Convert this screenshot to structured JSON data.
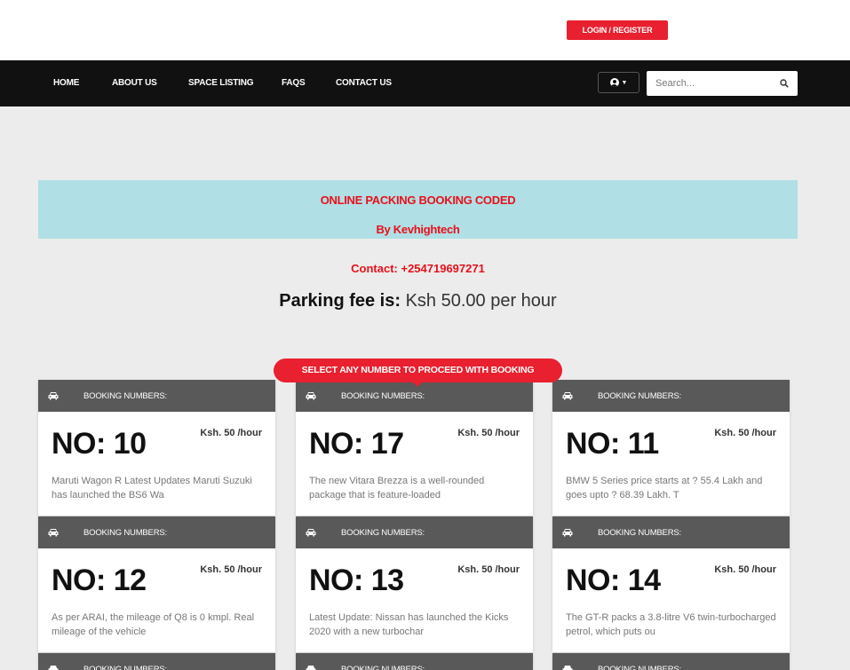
{
  "header": {
    "login_label": "LOGIN / REGISTER"
  },
  "nav": {
    "items": [
      {
        "label": "HOME"
      },
      {
        "label": "ABOUT US"
      },
      {
        "label": "SPACE LISTING"
      },
      {
        "label": "FAQS"
      },
      {
        "label": "CONTACT US"
      }
    ],
    "search_placeholder": "Search..."
  },
  "banner": {
    "title": "ONLINE PACKING BOOKING CODED",
    "by": "By Kevhightech"
  },
  "contact": "Contact: +254719697271",
  "fee": {
    "label": "Parking fee is:",
    "value": "Ksh 50.00 per hour"
  },
  "select_prompt": "SELECT ANY NUMBER TO PROCEED WITH BOOKING",
  "card_header_label": "BOOKING NUMBERS:",
  "cards": [
    {
      "number": "NO: 10",
      "price": "Ksh. 50 /hour",
      "description": "Maruti Wagon R Latest Updates Maruti Suzuki has launched the BS6 Wa"
    },
    {
      "number": "NO: 17",
      "price": "Ksh. 50 /hour",
      "description": "The new Vitara Brezza is a well-rounded package that is feature-loaded"
    },
    {
      "number": "NO: 11",
      "price": "Ksh. 50 /hour",
      "description": "BMW 5 Series price starts at ? 55.4 Lakh and goes upto ? 68.39 Lakh. T"
    },
    {
      "number": "NO: 12",
      "price": "Ksh. 50 /hour",
      "description": "As per ARAI, the mileage of Q8 is 0 kmpl. Real mileage of the vehicle"
    },
    {
      "number": "NO: 13",
      "price": "Ksh. 50 /hour",
      "description": "Latest Update: Nissan has launched the Kicks 2020 with a new turbochar"
    },
    {
      "number": "NO: 14",
      "price": "Ksh. 50 /hour",
      "description": "The GT-R packs a 3.8-litre V6 twin-turbocharged petrol, which puts ou"
    }
  ],
  "colors": {
    "accent": "#e8202f",
    "navbar": "#111111",
    "banner": "#b0dfe5",
    "card_header": "#595959"
  }
}
